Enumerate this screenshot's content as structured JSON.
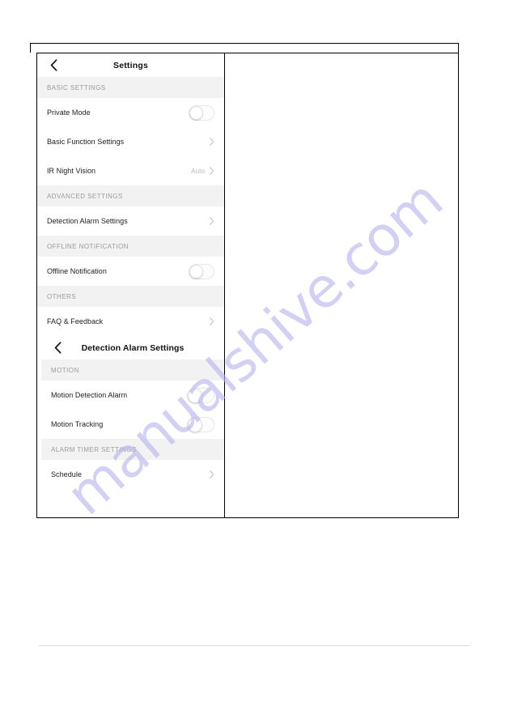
{
  "document": {
    "watermark": "manualshive.com"
  },
  "screenshots": [
    {
      "id": "settings",
      "nav": {
        "back_icon": "chevron-left-icon",
        "title": "Settings"
      },
      "sections": [
        {
          "header": "BASIC SETTINGS",
          "rows": [
            {
              "label": "Private Mode",
              "control": "toggle",
              "toggle_on": false
            },
            {
              "label": "Basic Function Settings",
              "control": "chevron",
              "value": ""
            },
            {
              "label": "IR Night Vision",
              "control": "chevron",
              "value": "Auto"
            }
          ]
        },
        {
          "header": "ADVANCED SETTINGS",
          "rows": [
            {
              "label": "Detection Alarm Settings",
              "control": "chevron",
              "value": ""
            }
          ]
        },
        {
          "header": "OFFLINE NOTIFICATION",
          "rows": [
            {
              "label": "Offline Notification",
              "control": "toggle",
              "toggle_on": false
            }
          ]
        },
        {
          "header": "OTHERS",
          "rows": [
            {
              "label": "FAQ & Feedback",
              "control": "chevron",
              "value": ""
            }
          ]
        }
      ]
    },
    {
      "id": "detection-alarm-settings",
      "nav": {
        "back_icon": "chevron-left-icon",
        "title": "Detection Alarm Settings"
      },
      "sections": [
        {
          "header": "MOTION",
          "rows": [
            {
              "label": "Motion Detection Alarm",
              "control": "toggle",
              "toggle_on": false
            },
            {
              "label": "Motion Tracking",
              "control": "toggle",
              "toggle_on": false
            }
          ]
        },
        {
          "header": "ALARM TIMER SETTINGS",
          "rows": [
            {
              "label": "Schedule",
              "control": "chevron",
              "value": ""
            }
          ]
        }
      ]
    }
  ]
}
